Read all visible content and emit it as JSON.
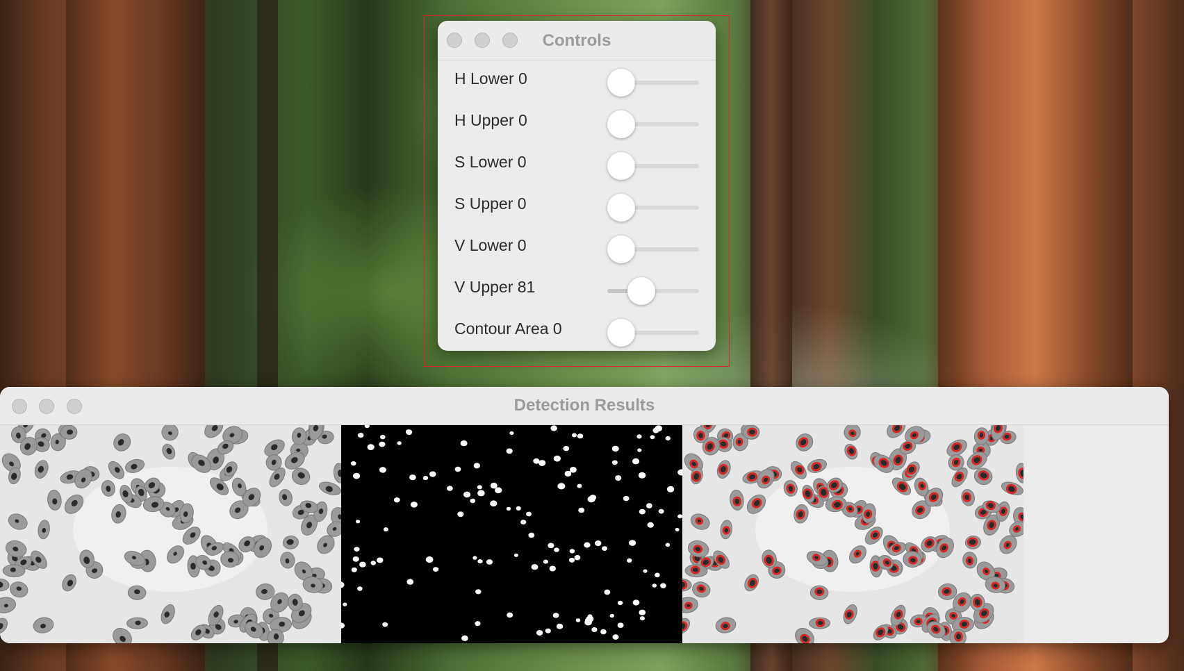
{
  "controls_window": {
    "title": "Controls",
    "sliders": [
      {
        "label": "H Lower 0",
        "value": 0,
        "max": 179
      },
      {
        "label": "H Upper 0",
        "value": 0,
        "max": 179
      },
      {
        "label": "S Lower 0",
        "value": 0,
        "max": 255
      },
      {
        "label": "S Upper 0",
        "value": 0,
        "max": 255
      },
      {
        "label": "V Lower 0",
        "value": 0,
        "max": 255
      },
      {
        "label": "V Upper 81",
        "value": 81,
        "max": 255
      },
      {
        "label": "Contour Area 0",
        "value": 0,
        "max": 1000
      }
    ]
  },
  "results_window": {
    "title": "Detection Results",
    "panels": [
      "original-grayscale",
      "binary-mask",
      "contour-overlay"
    ]
  },
  "colors": {
    "contour_red": "#e0201e",
    "mask_white": "#ffffff",
    "mask_black": "#000000",
    "window_bg": "#ececec"
  }
}
